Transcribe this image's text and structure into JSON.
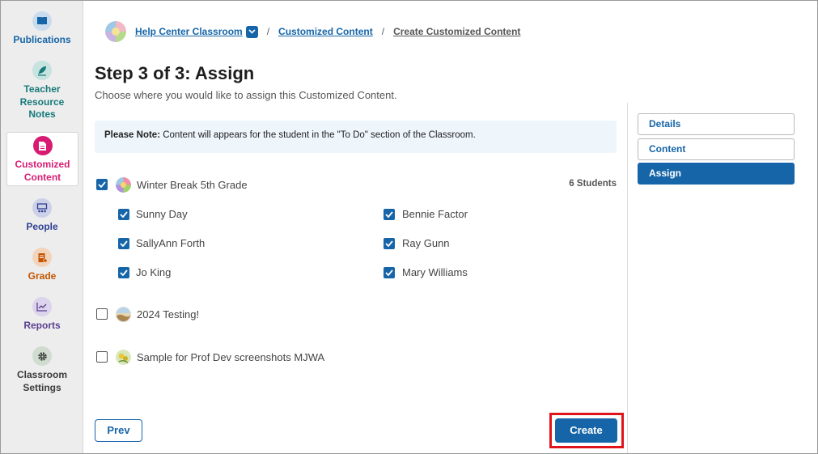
{
  "sidebar": {
    "items": [
      {
        "label_lines": [
          "Publications"
        ],
        "color": "#1565a8",
        "icon": "book-icon"
      },
      {
        "label_lines": [
          "Teacher",
          "Resource",
          "Notes"
        ],
        "color": "#177a7a",
        "icon": "feather-pen-icon"
      },
      {
        "label_lines": [
          "Customized",
          "Content"
        ],
        "color": "#d81b72",
        "icon": "document-icon"
      },
      {
        "label_lines": [
          "People"
        ],
        "color": "#2f3f8f",
        "icon": "people-board-icon"
      },
      {
        "label_lines": [
          "Grade"
        ],
        "color": "#c45400",
        "icon": "gradebook-icon"
      },
      {
        "label_lines": [
          "Reports"
        ],
        "color": "#5a3d8f",
        "icon": "chart-icon"
      },
      {
        "label_lines": [
          "Classroom",
          "Settings"
        ],
        "color": "#3b3b3b",
        "icon": "gear-icon"
      }
    ]
  },
  "breadcrumb": {
    "classroom": "Help Center Classroom",
    "section": "Customized Content",
    "current": "Create Customized Content",
    "separator": "/"
  },
  "page": {
    "title": "Step 3 of 3: Assign",
    "subtitle": "Choose where you would like to assign this Customized Content."
  },
  "note": {
    "prefix": "Please Note:",
    "text": " Content will appears for the student in the \"To Do\" section of the Classroom."
  },
  "classes": [
    {
      "name": "Winter Break 5th Grade",
      "checked": true,
      "count": "6 Students"
    },
    {
      "name": "2024 Testing!",
      "checked": false
    },
    {
      "name": "Sample for Prof Dev screenshots MJWA",
      "checked": false
    }
  ],
  "students": [
    {
      "name": "Sunny Day",
      "checked": true
    },
    {
      "name": "Bennie Factor",
      "checked": true
    },
    {
      "name": "SallyAnn Forth",
      "checked": true
    },
    {
      "name": "Ray Gunn",
      "checked": true
    },
    {
      "name": "Jo King",
      "checked": true
    },
    {
      "name": "Mary Williams",
      "checked": true
    }
  ],
  "steps": [
    {
      "label": "Details",
      "active": false
    },
    {
      "label": "Content",
      "active": false
    },
    {
      "label": "Assign",
      "active": true
    }
  ],
  "buttons": {
    "prev": "Prev",
    "create": "Create"
  },
  "colors": {
    "primary": "#1565a8",
    "highlight": "#e0151b",
    "note_bg": "#eef5fb"
  }
}
